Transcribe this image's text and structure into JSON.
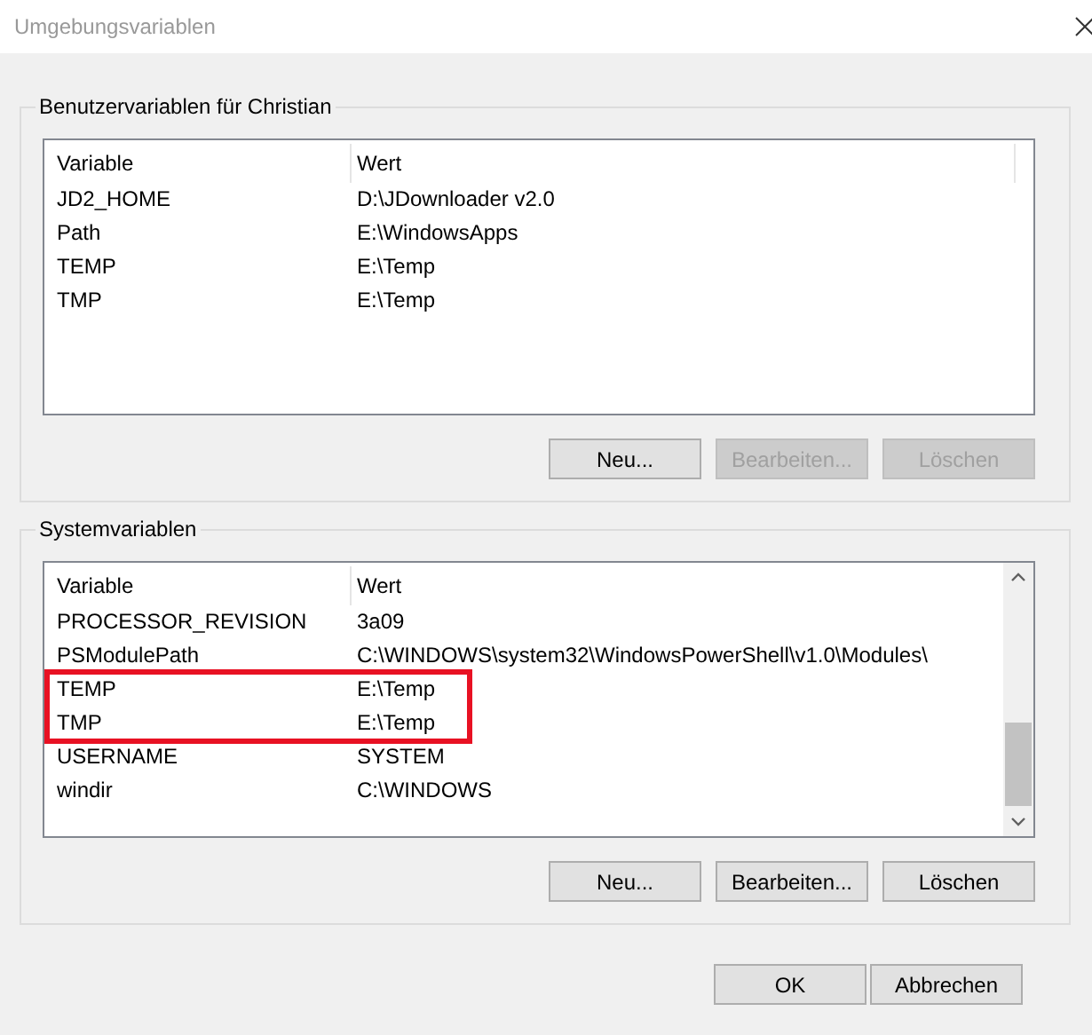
{
  "window": {
    "title": "Umgebungsvariablen"
  },
  "user_variables": {
    "legend": "Benutzervariablen für Christian",
    "columns": [
      "Variable",
      "Wert"
    ],
    "rows": [
      {
        "variable": "JD2_HOME",
        "value": "D:\\JDownloader v2.0"
      },
      {
        "variable": "Path",
        "value": "E:\\WindowsApps"
      },
      {
        "variable": "TEMP",
        "value": "E:\\Temp"
      },
      {
        "variable": "TMP",
        "value": "E:\\Temp"
      }
    ],
    "buttons": [
      {
        "label": "Neu...",
        "disabled": false
      },
      {
        "label": "Bearbeiten...",
        "disabled": true
      },
      {
        "label": "Löschen",
        "disabled": true
      }
    ]
  },
  "system_variables": {
    "legend": "Systemvariablen",
    "columns": [
      "Variable",
      "Wert"
    ],
    "rows": [
      {
        "variable": "PROCESSOR_REVISION",
        "value": "3a09",
        "highlighted": false
      },
      {
        "variable": "PSModulePath",
        "value": "C:\\WINDOWS\\system32\\WindowsPowerShell\\v1.0\\Modules\\",
        "highlighted": false
      },
      {
        "variable": "TEMP",
        "value": "E:\\Temp",
        "highlighted": true
      },
      {
        "variable": "TMP",
        "value": "E:\\Temp",
        "highlighted": true
      },
      {
        "variable": "USERNAME",
        "value": "SYSTEM",
        "highlighted": false
      },
      {
        "variable": "windir",
        "value": "C:\\WINDOWS",
        "highlighted": false
      }
    ],
    "buttons": [
      {
        "label": "Neu...",
        "disabled": false
      },
      {
        "label": "Bearbeiten...",
        "disabled": false
      },
      {
        "label": "Löschen",
        "disabled": false
      }
    ]
  },
  "dialog_buttons": [
    {
      "label": "OK",
      "disabled": false
    },
    {
      "label": "Abbrechen",
      "disabled": false
    }
  ]
}
